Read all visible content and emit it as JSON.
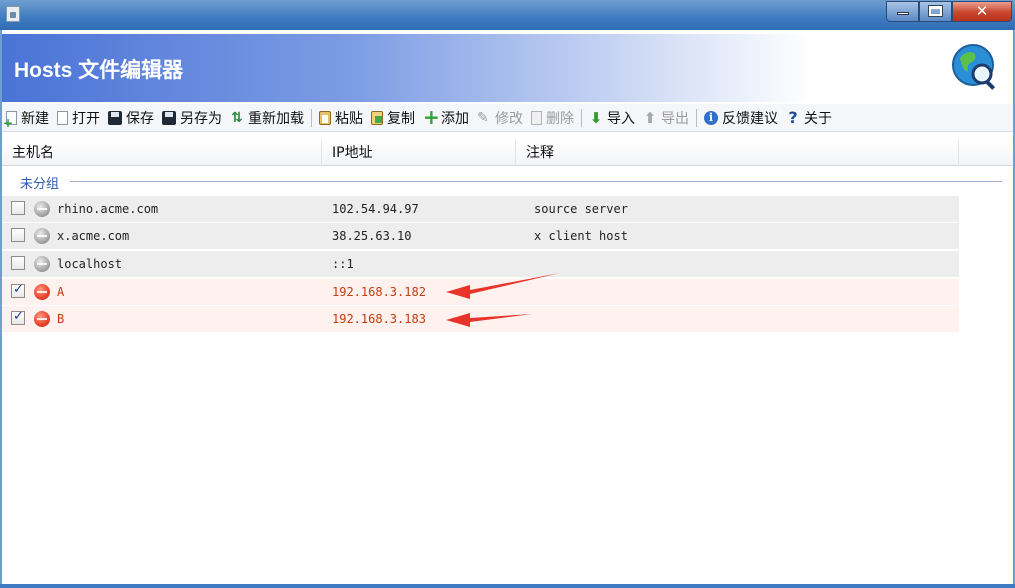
{
  "window": {
    "title": "",
    "controls": {
      "minimize": "",
      "maximize": "",
      "close": "✕"
    }
  },
  "banner": {
    "title": "Hosts 文件编辑器",
    "logo_icon": "globe-magnifier-icon"
  },
  "toolbar": {
    "items": [
      {
        "label": "新建",
        "icon": "new-file-icon",
        "disabled": false
      },
      {
        "label": "打开",
        "icon": "open-file-icon",
        "disabled": false
      },
      {
        "label": "保存",
        "icon": "save-disk-icon",
        "disabled": false
      },
      {
        "label": "另存为",
        "icon": "save-as-disk-icon",
        "disabled": false
      },
      {
        "label": "重新加载",
        "icon": "reload-icon",
        "disabled": false
      },
      {
        "label": "粘贴",
        "icon": "paste-icon",
        "disabled": false
      },
      {
        "label": "复制",
        "icon": "copy-icon",
        "disabled": false
      },
      {
        "label": "添加",
        "icon": "add-icon",
        "disabled": false
      },
      {
        "label": "修改",
        "icon": "edit-icon",
        "disabled": true
      },
      {
        "label": "删除",
        "icon": "delete-icon",
        "disabled": true
      },
      {
        "label": "导入",
        "icon": "import-icon",
        "disabled": false
      },
      {
        "label": "导出",
        "icon": "export-icon",
        "disabled": true
      },
      {
        "label": "反馈建议",
        "icon": "info-icon",
        "disabled": false
      },
      {
        "label": "关于",
        "icon": "help-icon",
        "disabled": false
      }
    ]
  },
  "table": {
    "columns": [
      "主机名",
      "IP地址",
      "注释"
    ],
    "group": "未分组",
    "rows": [
      {
        "checked": false,
        "active": false,
        "host": "rhino.acme.com",
        "ip": "102.54.94.97",
        "note": "source server"
      },
      {
        "checked": false,
        "active": false,
        "host": "x.acme.com",
        "ip": "38.25.63.10",
        "note": "x client host"
      },
      {
        "checked": false,
        "active": false,
        "host": "localhost",
        "ip": "::1",
        "note": ""
      },
      {
        "checked": true,
        "active": true,
        "host": "A",
        "ip": "192.168.3.182",
        "note": ""
      },
      {
        "checked": true,
        "active": true,
        "host": "B",
        "ip": "192.168.3.183",
        "note": ""
      }
    ]
  },
  "colors": {
    "accent": "#4a73d6",
    "active_text": "#c13c10",
    "annotation_arrow": "#e8342a"
  }
}
